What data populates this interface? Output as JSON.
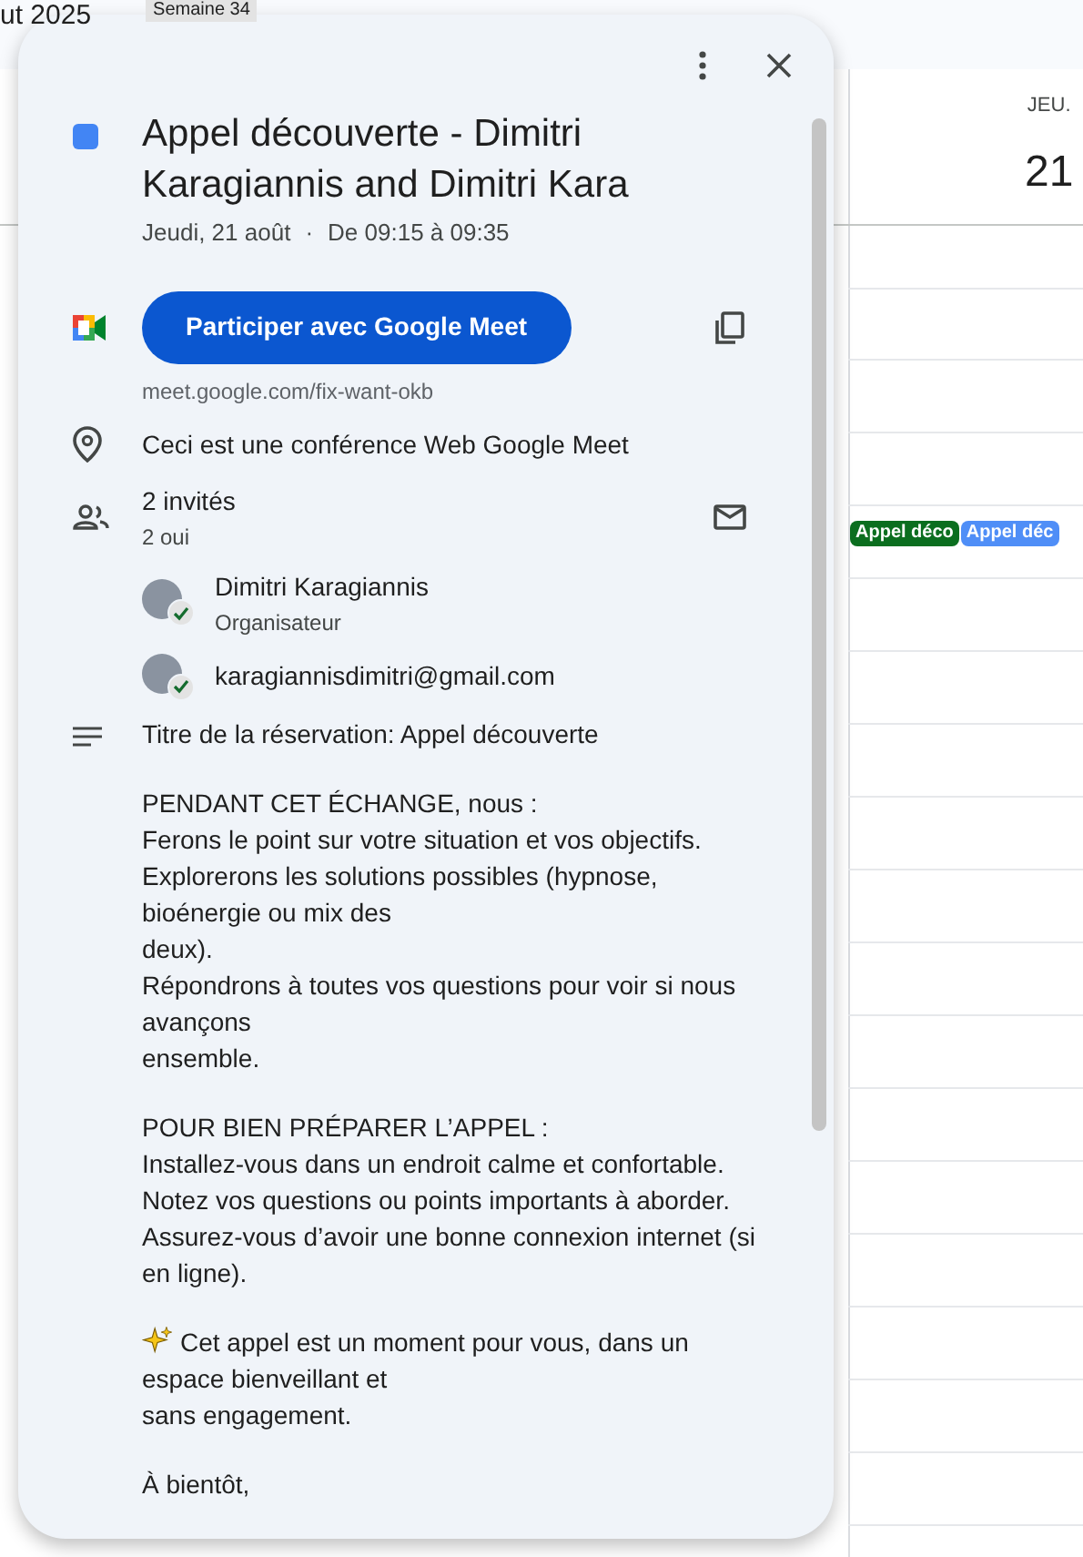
{
  "calendar_header": {
    "month": "ut 2025",
    "week_badge": "Semaine 34"
  },
  "day_column": {
    "weekday": "JEU.",
    "day": "21"
  },
  "calendar_events": [
    {
      "label": "Appel déco",
      "color": "#0b6e1f"
    },
    {
      "label": "Appel déc",
      "color": "#4f8ef7"
    }
  ],
  "event": {
    "color": "#4285f4",
    "title_lines": [
      "Appel découverte - Dimitri",
      "Karagiannis and Dimitri Kara"
    ],
    "date": "Jeudi, 21 août",
    "separator": "·",
    "time": "De 09:15 à 09:35",
    "meet_button": "Participer avec Google Meet",
    "meet_link": "meet.google.com/fix-want-okb",
    "location": "Ceci est une conférence Web Google Meet",
    "guests_count": "2 invités",
    "guests_responses": "2 oui",
    "guests": [
      {
        "name": "Dimitri Karagiannis",
        "role": "Organisateur",
        "accepted": true
      },
      {
        "name": "karagiannisdimitri@gmail.com",
        "accepted": true
      }
    ],
    "description": [
      {
        "lines": [
          "Titre de la réservation: Appel découverte"
        ]
      },
      {
        "lines": [
          "PENDANT CET ÉCHANGE, nous :",
          "Ferons le point sur votre situation et vos objectifs.",
          "Explorerons les solutions possibles (hypnose,",
          "bioénergie ou mix des",
          "deux).",
          "Répondrons à toutes vos questions pour voir si nous",
          "avançons",
          "ensemble."
        ]
      },
      {
        "lines": [
          "POUR BIEN PRÉPARER L’APPEL :",
          "Installez-vous dans un endroit calme et confortable.",
          "Notez vos questions ou points importants à aborder.",
          "Assurez-vous d’avoir une bonne connexion internet (si",
          "en ligne)."
        ]
      },
      {
        "kind": "sparkle",
        "lines": [
          "Cet appel est un moment pour vous, dans un",
          "espace bienveillant et",
          "sans engagement."
        ]
      },
      {
        "lines": [
          "À bientôt,"
        ]
      }
    ]
  }
}
